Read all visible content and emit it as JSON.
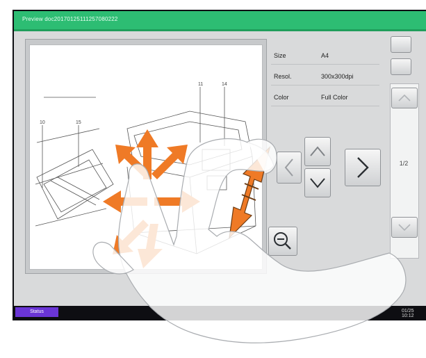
{
  "window": {
    "title": "Preview doc20170125111257080222"
  },
  "info": {
    "rows": [
      {
        "label": "Size",
        "value": "A4"
      },
      {
        "label": "Resol.",
        "value": "300x300dpi"
      },
      {
        "label": "Color",
        "value": "Full Color"
      }
    ]
  },
  "navigation": {
    "page_indicator": "1/2"
  },
  "status": {
    "button_label": "Status",
    "clock": "01/25 10:12"
  },
  "colors": {
    "titlebar": "#2dbd73",
    "panel": "#d9dadb",
    "status_button": "#6a35d6",
    "gesture_arrows": "#ef7a26"
  },
  "icons": {
    "zoom": "zoom-out-icon",
    "up": "chevron-up-icon",
    "down": "chevron-down-icon",
    "left": "chevron-left-icon",
    "right": "chevron-right-icon"
  }
}
